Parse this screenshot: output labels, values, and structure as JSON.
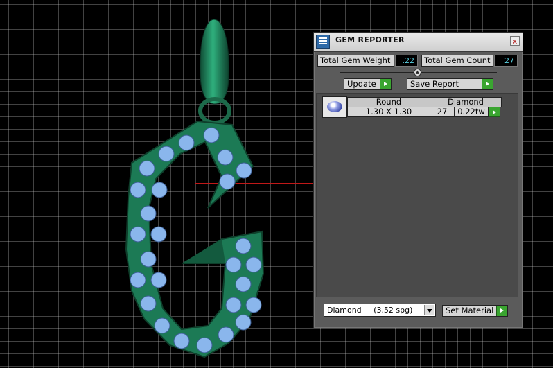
{
  "panel": {
    "title": "GEM REPORTER",
    "close_label": "x",
    "total_weight_label": "Total Gem Weight",
    "total_weight_value": ".22",
    "total_count_label": "Total Gem Count",
    "total_count_value": "27",
    "update_label": "Update",
    "save_report_label": "Save Report",
    "gems": [
      {
        "shape": "Round",
        "material": "Diamond",
        "size": "1.30 X 1.30",
        "count": "27",
        "weight": "0.22tw"
      }
    ],
    "material_select_value": "Diamond     (3.52 spg)",
    "set_material_label": "Set Material"
  },
  "colors": {
    "metal": "#1c7a55",
    "stone": "#8ab6ec",
    "axis_vertical": "#2aa3b8",
    "axis_horizontal": "#c01818",
    "accent_button": "#3aa530"
  },
  "icons": [
    "app-icon",
    "close-icon",
    "slider-thumb-icon",
    "arrow-right-icon",
    "dropdown-icon",
    "gem-thumbnail"
  ]
}
